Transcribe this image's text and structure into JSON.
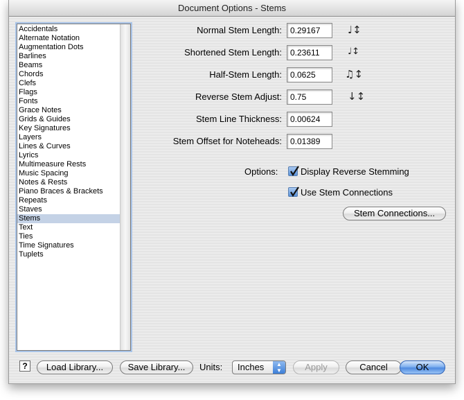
{
  "window": {
    "title": "Document Options - Stems"
  },
  "sidebar": {
    "items": [
      "Accidentals",
      "Alternate Notation",
      "Augmentation Dots",
      "Barlines",
      "Beams",
      "Chords",
      "Clefs",
      "Flags",
      "Fonts",
      "Grace Notes",
      "Grids & Guides",
      "Key Signatures",
      "Layers",
      "Lines & Curves",
      "Lyrics",
      "Multimeasure Rests",
      "Music Spacing",
      "Notes & Rests",
      "Piano Braces & Brackets",
      "Repeats",
      "Staves",
      "Stems",
      "Text",
      "Ties",
      "Time Signatures",
      "Tuplets"
    ],
    "selected": "Stems"
  },
  "fields": [
    {
      "label": "Normal Stem Length:",
      "value": "0.29167",
      "icon": "normal-stem-length-icon"
    },
    {
      "label": "Shortened Stem Length:",
      "value": "0.23611",
      "icon": "shortened-stem-length-icon"
    },
    {
      "label": "Half-Stem Length:",
      "value": "0.0625",
      "icon": "half-stem-length-icon"
    },
    {
      "label": "Reverse Stem Adjust:",
      "value": "0.75",
      "icon": "reverse-stem-adjust-icon"
    },
    {
      "label": "Stem Line Thickness:",
      "value": "0.00624"
    },
    {
      "label": "Stem Offset for Noteheads:",
      "value": "0.01389"
    }
  ],
  "options": {
    "label": "Options:",
    "display_reverse_stemming": {
      "label": "Display Reverse Stemming",
      "checked": true
    },
    "use_stem_connections": {
      "label": "Use Stem Connections",
      "checked": true
    },
    "stem_connections_button": "Stem Connections..."
  },
  "footer": {
    "help": "?",
    "load_library": "Load Library...",
    "save_library": "Save Library...",
    "units_label": "Units:",
    "units_value": "Inches",
    "apply": "Apply",
    "cancel": "Cancel",
    "ok": "OK"
  },
  "colors": {
    "selection": "#c4d2e6",
    "default_button": "#4f8be0",
    "focus_ring": "#a9c4e8"
  }
}
